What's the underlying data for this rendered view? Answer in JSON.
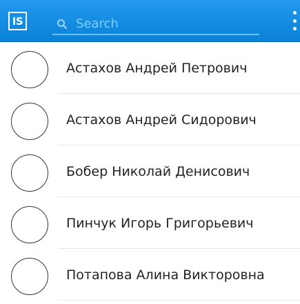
{
  "app": {
    "logo_text": "IS",
    "accent_color": "#1a8fe3"
  },
  "search": {
    "placeholder": "Search",
    "value": "",
    "icon": "search-icon"
  },
  "menu": {
    "icon": "more-vert-icon"
  },
  "contacts": [
    {
      "name": "Астахов Андрей Петрович"
    },
    {
      "name": "Астахов Андрей Сидорович"
    },
    {
      "name": "Бобер Николай Денисович"
    },
    {
      "name": "Пинчук Игорь Григорьевич"
    },
    {
      "name": "Потапова Алина Викторовна"
    }
  ]
}
